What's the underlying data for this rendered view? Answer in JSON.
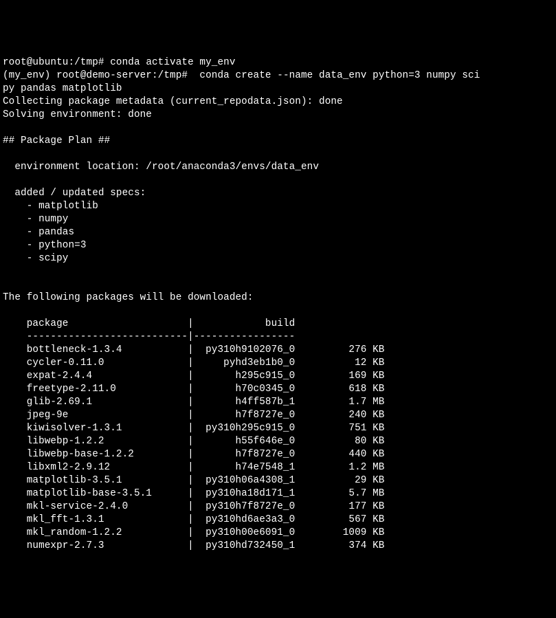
{
  "line1": {
    "prompt": "root@ubuntu:/tmp#",
    "cmd": " conda activate my_env"
  },
  "line2": {
    "prompt": "(my_env) root@demo-server:/tmp#",
    "cmd": "  conda create --name data_env python=3 numpy sci"
  },
  "line3": "py pandas matplotlib",
  "line4": "Collecting package metadata (current_repodata.json): done",
  "line5": "Solving environment: done",
  "plan_header": "## Package Plan ##",
  "env_location": "  environment location: /root/anaconda3/envs/data_env",
  "specs_header": "  added / updated specs:",
  "specs": [
    "    - matplotlib",
    "    - numpy",
    "    - pandas",
    "    - python=3",
    "    - scipy"
  ],
  "download_header": "The following packages will be downloaded:",
  "table_header": "    package                    |            build",
  "table_divider": "    ---------------------------|-----------------",
  "packages": [
    {
      "line": "    bottleneck-1.3.4           |  py310h9102076_0         276 KB"
    },
    {
      "line": "    cycler-0.11.0              |     pyhd3eb1b0_0          12 KB"
    },
    {
      "line": "    expat-2.4.4                |       h295c915_0         169 KB"
    },
    {
      "line": "    freetype-2.11.0            |       h70c0345_0         618 KB"
    },
    {
      "line": "    glib-2.69.1                |       h4ff587b_1         1.7 MB"
    },
    {
      "line": "    jpeg-9e                    |       h7f8727e_0         240 KB"
    },
    {
      "line": "    kiwisolver-1.3.1           |  py310h295c915_0         751 KB"
    },
    {
      "line": "    libwebp-1.2.2              |       h55f646e_0          80 KB"
    },
    {
      "line": "    libwebp-base-1.2.2         |       h7f8727e_0         440 KB"
    },
    {
      "line": "    libxml2-2.9.12             |       h74e7548_1         1.2 MB"
    },
    {
      "line": "    matplotlib-3.5.1           |  py310h06a4308_1          29 KB"
    },
    {
      "line": "    matplotlib-base-3.5.1      |  py310ha18d171_1         5.7 MB"
    },
    {
      "line": "    mkl-service-2.4.0          |  py310h7f8727e_0         177 KB"
    },
    {
      "line": "    mkl_fft-1.3.1              |  py310hd6ae3a3_0         567 KB"
    },
    {
      "line": "    mkl_random-1.2.2           |  py310h00e6091_0        1009 KB"
    },
    {
      "line": "    numexpr-2.7.3              |  py310hd732450_1         374 KB"
    }
  ]
}
